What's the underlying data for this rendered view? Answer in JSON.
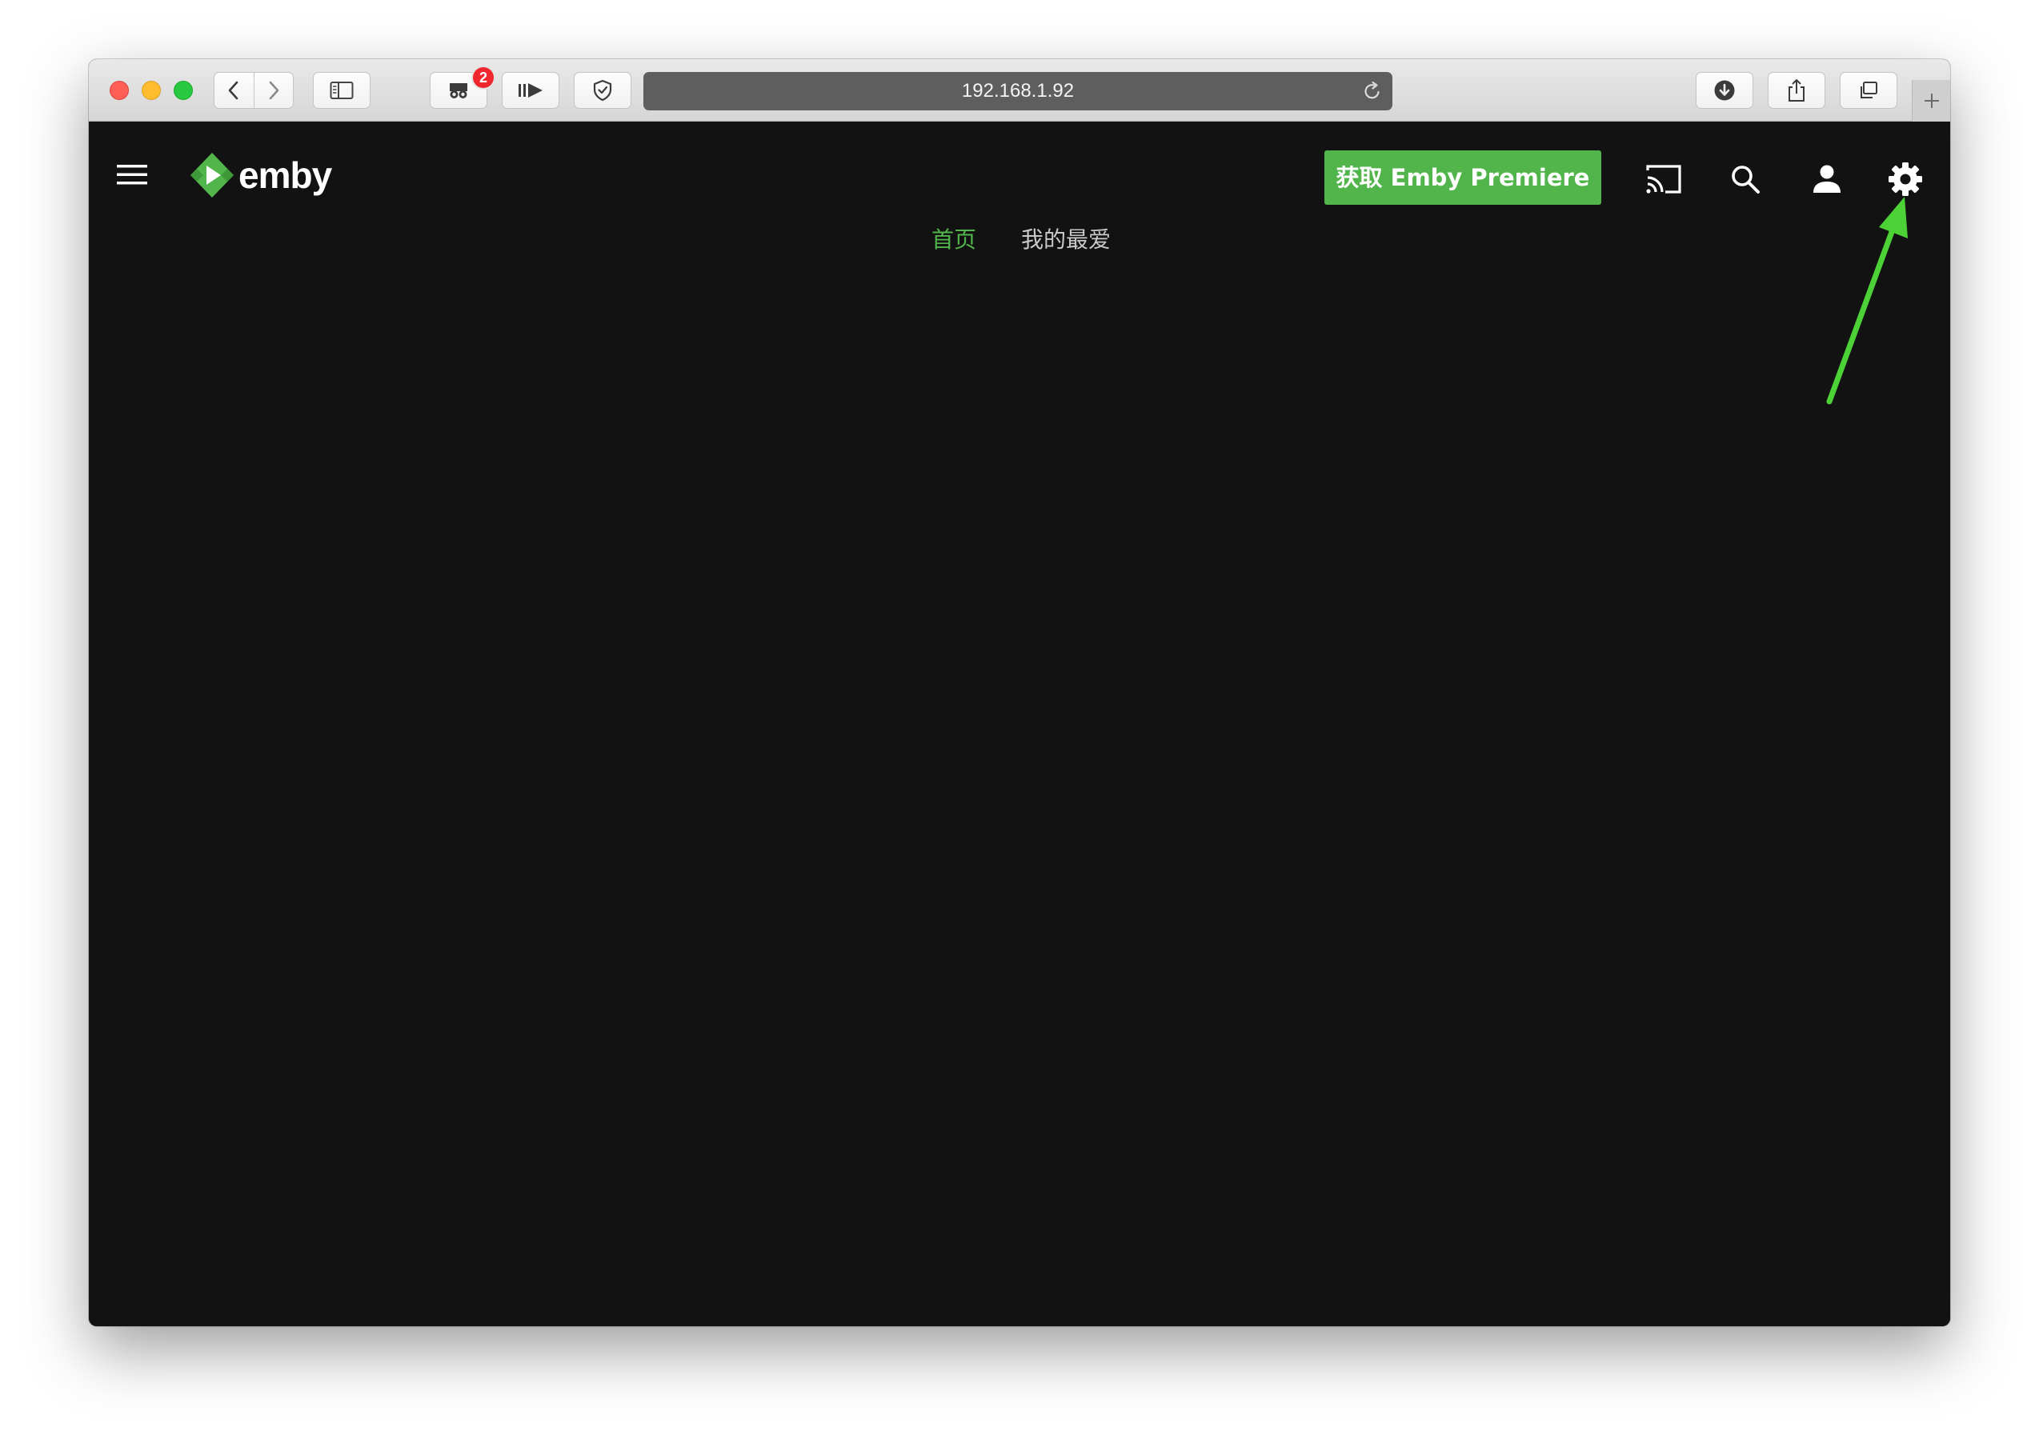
{
  "browser": {
    "url": "192.168.1.92",
    "tab_badge_count": "2",
    "icons": {
      "back": "chevron-left-icon",
      "forward": "chevron-right-icon",
      "sidebar": "sidebar-icon",
      "extension": "mask-extension-icon",
      "media": "play-forward-icon",
      "privacy": "shield-check-icon",
      "reload": "reload-icon",
      "downloads": "download-icon",
      "share": "share-icon",
      "tabs": "tab-overview-icon",
      "new_tab": "plus-icon"
    }
  },
  "app": {
    "logo_text": "emby",
    "premiere_button": "获取 Emby Premiere",
    "header_icons": [
      "menu-icon",
      "cast-icon",
      "search-icon",
      "user-icon",
      "gear-icon"
    ],
    "tabs": [
      {
        "label": "首页",
        "active": true
      },
      {
        "label": "我的最爱",
        "active": false
      }
    ]
  },
  "colors": {
    "accent_green": "#52b54b",
    "app_background": "#121212",
    "annotation_arrow": "#4cd137"
  }
}
